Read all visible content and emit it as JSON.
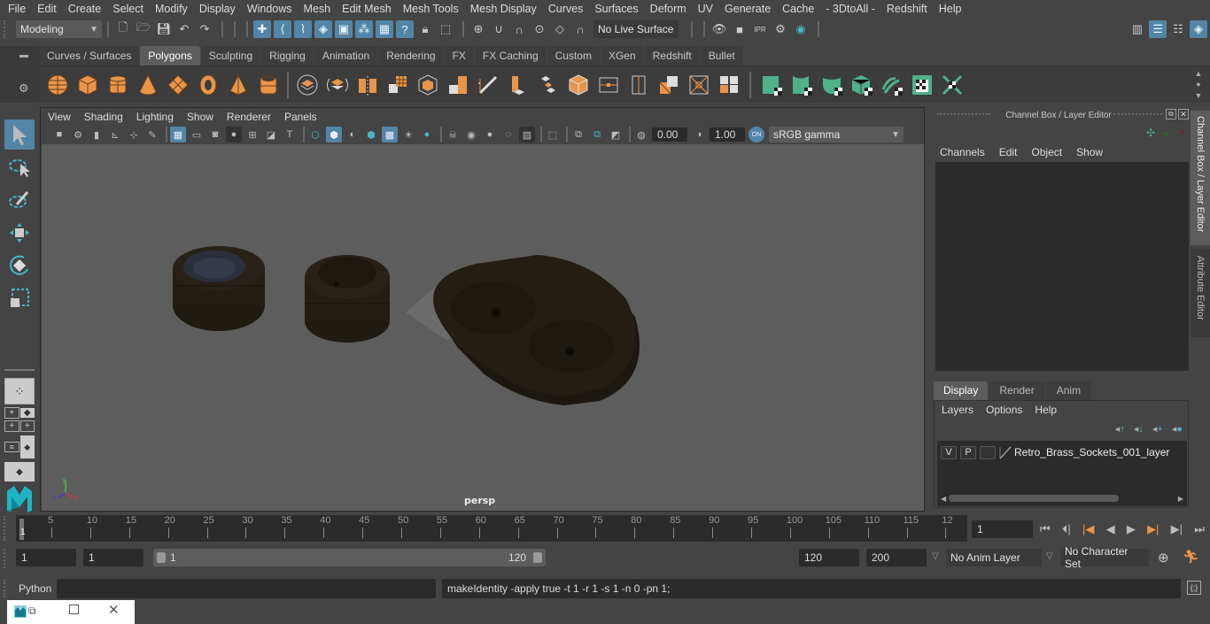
{
  "menubar": {
    "items": [
      "File",
      "Edit",
      "Create",
      "Select",
      "Modify",
      "Display",
      "Windows",
      "Mesh",
      "Edit Mesh",
      "Mesh Tools",
      "Mesh Display",
      "Curves",
      "Surfaces",
      "Deform",
      "UV",
      "Generate",
      "Cache",
      "- 3DtoAll -",
      "Redshift",
      "Help"
    ]
  },
  "statusline": {
    "mode": "Modeling",
    "live_surface": "No Live Surface"
  },
  "shelf": {
    "tabs": [
      "Curves / Surfaces",
      "Polygons",
      "Sculpting",
      "Rigging",
      "Animation",
      "Rendering",
      "FX",
      "FX Caching",
      "Custom",
      "XGen",
      "Redshift",
      "Bullet"
    ],
    "active_tab": "Polygons",
    "accent_orange": "#e8954a",
    "accent_green": "#4fb08a"
  },
  "viewport": {
    "menu": [
      "View",
      "Shading",
      "Lighting",
      "Show",
      "Renderer",
      "Panels"
    ],
    "exposure": "0.00",
    "gamma": "1.00",
    "color_space": "sRGB gamma",
    "camera_label": "persp",
    "axis": {
      "x": "x",
      "y": "y",
      "z": "z"
    }
  },
  "channel_box": {
    "title": "Channel Box / Layer Editor",
    "menu": [
      "Channels",
      "Edit",
      "Object",
      "Show"
    ]
  },
  "side_tabs": [
    "Channel Box / Layer Editor",
    "Attribute Editor"
  ],
  "layer_editor": {
    "tabs": [
      "Display",
      "Render",
      "Anim"
    ],
    "active_tab": "Display",
    "menu": [
      "Layers",
      "Options",
      "Help"
    ],
    "layers": [
      {
        "v": "V",
        "p": "P",
        "name": "Retro_Brass_Sockets_001_layer"
      }
    ]
  },
  "timeline": {
    "ticks": [
      "5",
      "10",
      "15",
      "20",
      "25",
      "30",
      "35",
      "40",
      "45",
      "50",
      "55",
      "60",
      "65",
      "70",
      "75",
      "80",
      "85",
      "90",
      "95",
      "100",
      "105",
      "110",
      "115",
      "12"
    ],
    "current_frame_marker": "1",
    "current_frame": "1"
  },
  "range": {
    "start": "1",
    "playback_start": "1",
    "slider_start": "1",
    "slider_end": "120",
    "playback_end": "120",
    "end": "200",
    "anim_layer": "No Anim Layer",
    "character_set": "No Character Set"
  },
  "command": {
    "language": "Python",
    "input": "",
    "result": "makeIdentity -apply true -t 1 -r 1 -s 1 -n 0 -pn 1;"
  }
}
